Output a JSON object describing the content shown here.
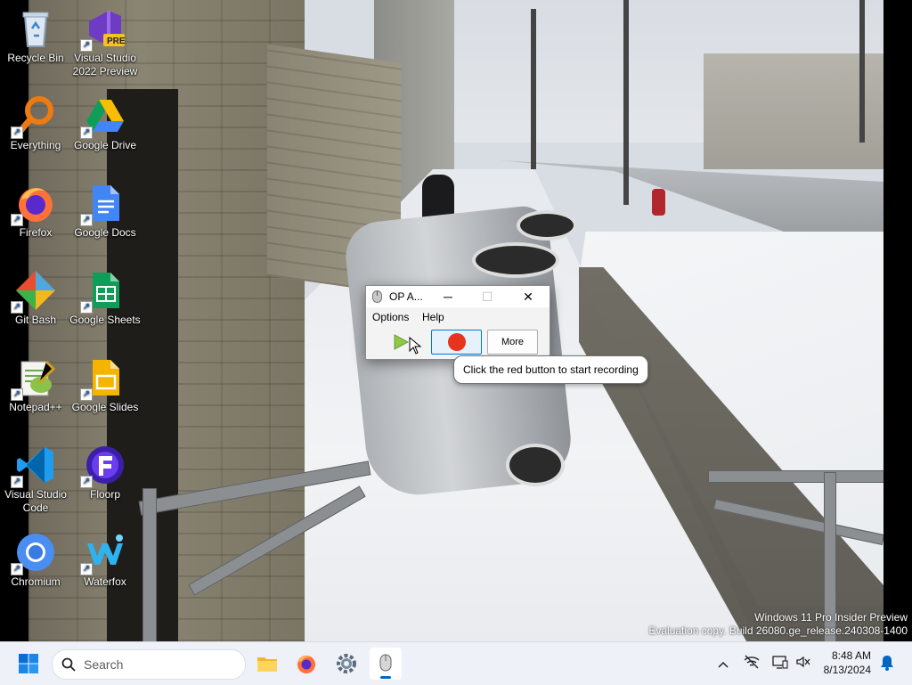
{
  "desktop": {
    "icons": [
      {
        "label": "Recycle Bin",
        "icon": "recycle-bin-icon"
      },
      {
        "label": "Visual Studio 2022 Preview",
        "icon": "visual-studio-preview-icon",
        "badge": "PRE"
      },
      {
        "label": "Everything",
        "icon": "everything-search-icon"
      },
      {
        "label": "Google Drive",
        "icon": "google-drive-icon"
      },
      {
        "label": "Firefox",
        "icon": "firefox-icon"
      },
      {
        "label": "Google Docs",
        "icon": "google-docs-icon"
      },
      {
        "label": "Git Bash",
        "icon": "git-bash-icon"
      },
      {
        "label": "Google Sheets",
        "icon": "google-sheets-icon"
      },
      {
        "label": "Notepad++",
        "icon": "notepad-plus-plus-icon"
      },
      {
        "label": "Google Slides",
        "icon": "google-slides-icon"
      },
      {
        "label": "Visual Studio Code",
        "icon": "vscode-icon"
      },
      {
        "label": "Floorp",
        "icon": "floorp-icon"
      },
      {
        "label": "Chromium",
        "icon": "chromium-icon"
      },
      {
        "label": "Waterfox",
        "icon": "waterfox-icon"
      }
    ]
  },
  "app_window": {
    "title": "OP A...",
    "minimize": "─",
    "maximize": "☐",
    "close": "✕",
    "menu": [
      "Options",
      "Help"
    ],
    "buttons": {
      "play_icon": "play-icon",
      "record_icon": "record-icon",
      "more_label": "More"
    },
    "tooltip": "Click the red button to start recording"
  },
  "watermark": {
    "line1": "Windows 11 Pro Insider Preview",
    "line2": "Evaluation copy. Build 26080.ge_release.240308-1400"
  },
  "taskbar": {
    "search_placeholder": "Search",
    "pinned": [
      "file-explorer-icon",
      "firefox-icon",
      "settings-gear-icon",
      "mouse-app-icon"
    ],
    "tray": [
      "chevron-up-icon",
      "network-off-icon",
      "display-icon",
      "volume-muted-icon",
      "notification-bell-icon"
    ],
    "time": "8:48 AM",
    "date": "8/13/2024"
  },
  "colors": {
    "accent": "#0067c0",
    "record_red": "#e8341c",
    "play_green": "#8fc74a",
    "taskbar_bg": "#eef1f7"
  }
}
